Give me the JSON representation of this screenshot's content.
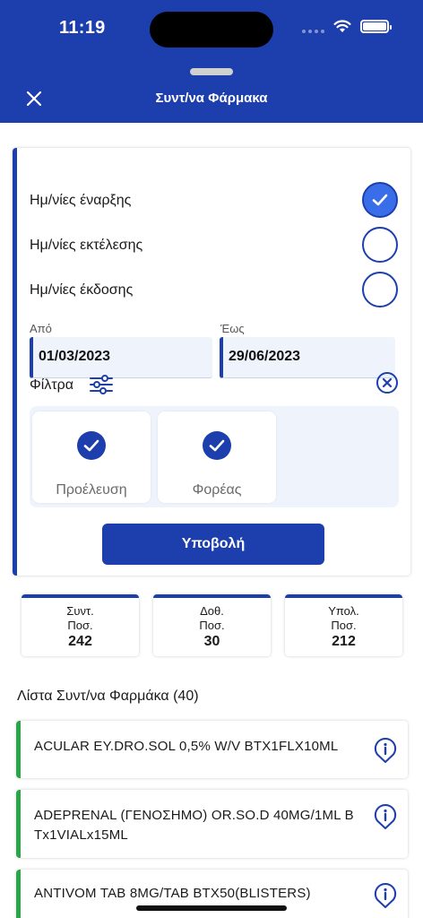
{
  "status_bar": {
    "time": "11:19"
  },
  "header": {
    "title": "Συντ/να Φάρμακα",
    "close_icon": "close-icon"
  },
  "date_type": {
    "options": [
      {
        "label": "Ημ/νίες έναρξης",
        "selected": true
      },
      {
        "label": "Ημ/νίες εκτέλεσης",
        "selected": false
      },
      {
        "label": "Ημ/νίες έκδοσης",
        "selected": false
      }
    ]
  },
  "date_range": {
    "from_label": "Από",
    "from_value": "01/03/2023",
    "to_label": "Έως",
    "to_value": "29/06/2023"
  },
  "filters": {
    "label": "Φίλτρα",
    "chips": [
      {
        "label": "Προέλευση",
        "checked": true
      },
      {
        "label": "Φορέας",
        "checked": true
      }
    ]
  },
  "submit_label": "Υποβολή",
  "stats": [
    {
      "line1": "Συντ.",
      "line2": "Ποσ.",
      "value": "242"
    },
    {
      "line1": "Δοθ.",
      "line2": "Ποσ.",
      "value": "30"
    },
    {
      "line1": "Υπολ.",
      "line2": "Ποσ.",
      "value": "212"
    }
  ],
  "list": {
    "title": "Λίστα Συντ/να Φαρμάκα (40)",
    "items": [
      {
        "name": "ACULAR EY.DRO.SOL 0,5% W/V BTX1FLX10ML"
      },
      {
        "name": "ADEPRENAL (ΓΕΝΟΣΗΜΟ) OR.SO.D 40MG/1ML BTx1VIALx15ML"
      },
      {
        "name": "ANTIVOM TAB 8MG/TAB BTX50(BLISTERS)"
      }
    ]
  },
  "colors": {
    "primary": "#1d3fae",
    "accent_green": "#2aa548",
    "selected_radio": "#3a6ee8"
  }
}
